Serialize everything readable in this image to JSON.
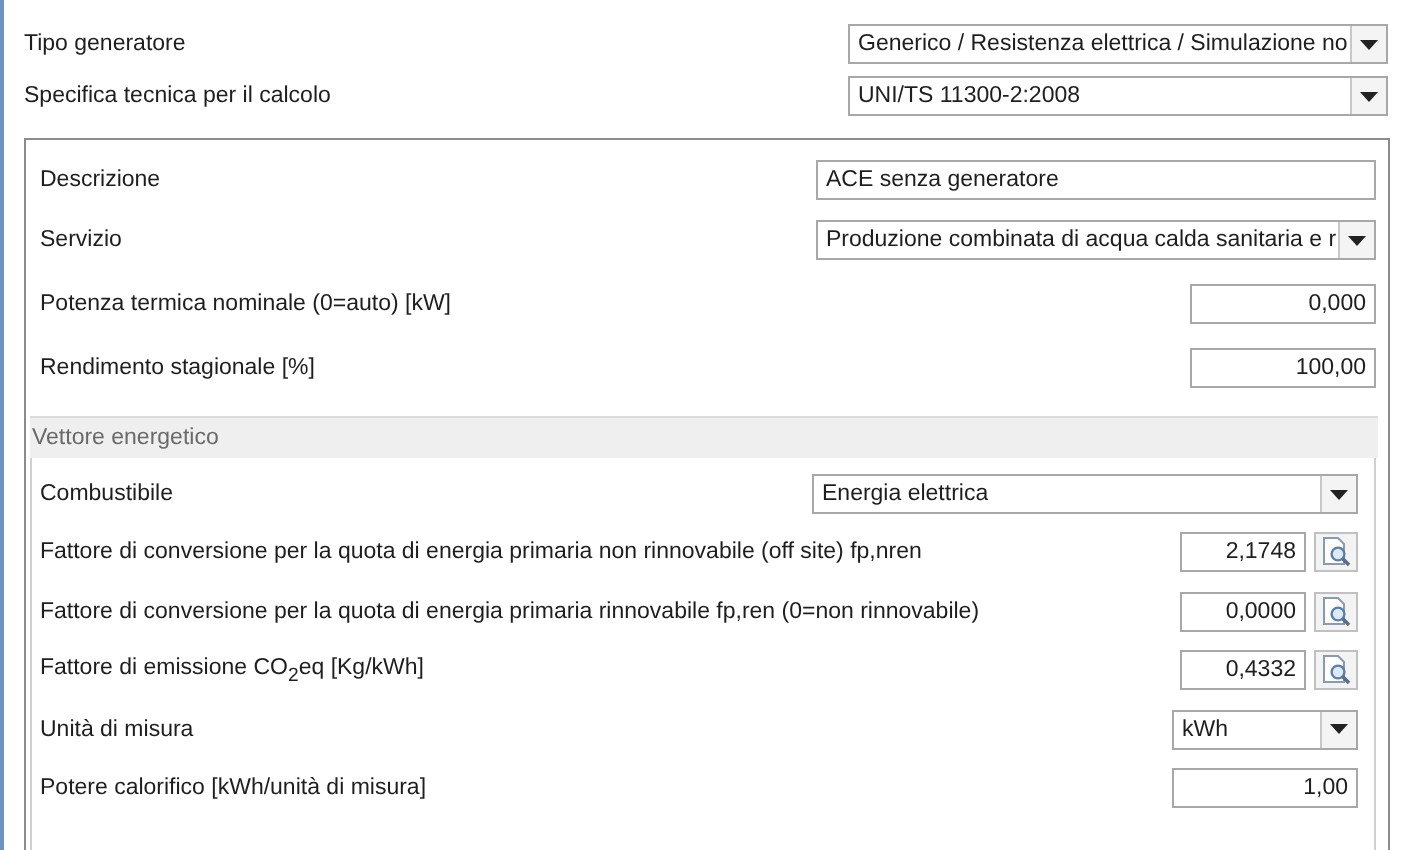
{
  "general": [
    {
      "label": "Tipo generatore",
      "kind": "select",
      "value": "Generico / Resistenza elettrica / Simulazione no"
    },
    {
      "label": "Specifica tecnica per il calcolo",
      "kind": "select",
      "value": "UNI/TS 11300-2:2008"
    }
  ],
  "generator": [
    {
      "label": "Descrizione",
      "kind": "text",
      "value": "ACE senza generatore"
    },
    {
      "label": "Servizio",
      "kind": "select",
      "value": "Produzione combinata di acqua calda sanitaria e r"
    },
    {
      "label": "Potenza termica nominale (0=auto) [kW]",
      "kind": "number",
      "value": "0,000"
    },
    {
      "label": "Rendimento stagionale [%]",
      "kind": "number",
      "value": "100,00"
    }
  ],
  "energy_carrier": {
    "title": "Vettore energetico",
    "fields": [
      {
        "label": "Combustibile",
        "kind": "select",
        "value": "Energia elettrica"
      },
      {
        "label": "Fattore di conversione per la quota di energia primaria non rinnovabile (off site) fp,nren",
        "kind": "lookup",
        "value": "2,1748"
      },
      {
        "label": "Fattore di conversione per la quota di energia primaria rinnovabile fp,ren (0=non rinnovabile)",
        "kind": "lookup",
        "value": "0,0000"
      },
      {
        "label": "Fattore di emissione CO$_{2}$eq [Kg/kWh]",
        "kind": "lookup",
        "value": "0,4332"
      },
      {
        "label": "Unità di misura",
        "kind": "select",
        "value": "kWh"
      },
      {
        "label": "Potere calorifico [kWh/unità di misura]",
        "kind": "number",
        "value": "1,00"
      }
    ]
  }
}
